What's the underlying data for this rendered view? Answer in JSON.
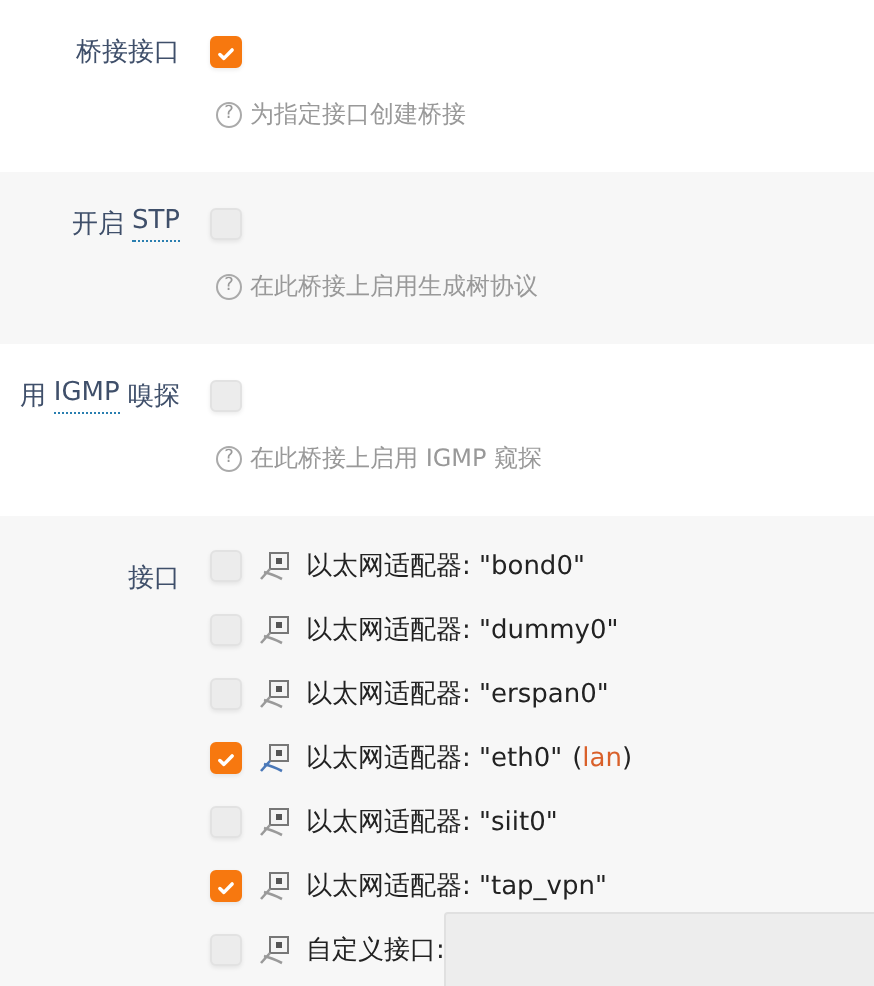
{
  "sections": [
    {
      "label": [
        {
          "kind": "text",
          "text": "桥接接口"
        }
      ],
      "checked": true,
      "help_icon": "?",
      "help": "为指定接口创建桥接"
    },
    {
      "label": [
        {
          "kind": "text",
          "text": "开启 "
        },
        {
          "kind": "abbr",
          "text": "STP"
        }
      ],
      "checked": false,
      "help_icon": "?",
      "help": "在此桥接上启用生成树协议"
    },
    {
      "label": [
        {
          "kind": "text",
          "text": "用 "
        },
        {
          "kind": "abbr",
          "text": "IGMP"
        },
        {
          "kind": "text",
          "text": " 嗅探"
        }
      ],
      "checked": false,
      "help_icon": "?",
      "help": "在此桥接上启用 IGMP 窥探"
    }
  ],
  "interfaces": {
    "label": "接口",
    "items": [
      {
        "kind": "adapter",
        "label": "以太网适配器: \"bond0\"",
        "checked": false,
        "active": false
      },
      {
        "kind": "adapter",
        "label": "以太网适配器: \"dummy0\"",
        "checked": false,
        "active": false
      },
      {
        "kind": "adapter",
        "label": "以太网适配器: \"erspan0\"",
        "checked": false,
        "active": false
      },
      {
        "kind": "adapter",
        "label": "以太网适配器: \"eth0\"",
        "checked": true,
        "active": true,
        "zone_open": "(",
        "zone": "lan",
        "zone_close": ")"
      },
      {
        "kind": "adapter",
        "label": "以太网适配器: \"siit0\"",
        "checked": false,
        "active": false
      },
      {
        "kind": "adapter",
        "label": "以太网适配器: \"tap_vpn\"",
        "checked": true,
        "active": false
      },
      {
        "kind": "custom",
        "label": "自定义接口:",
        "checked": false,
        "active": false
      }
    ]
  }
}
